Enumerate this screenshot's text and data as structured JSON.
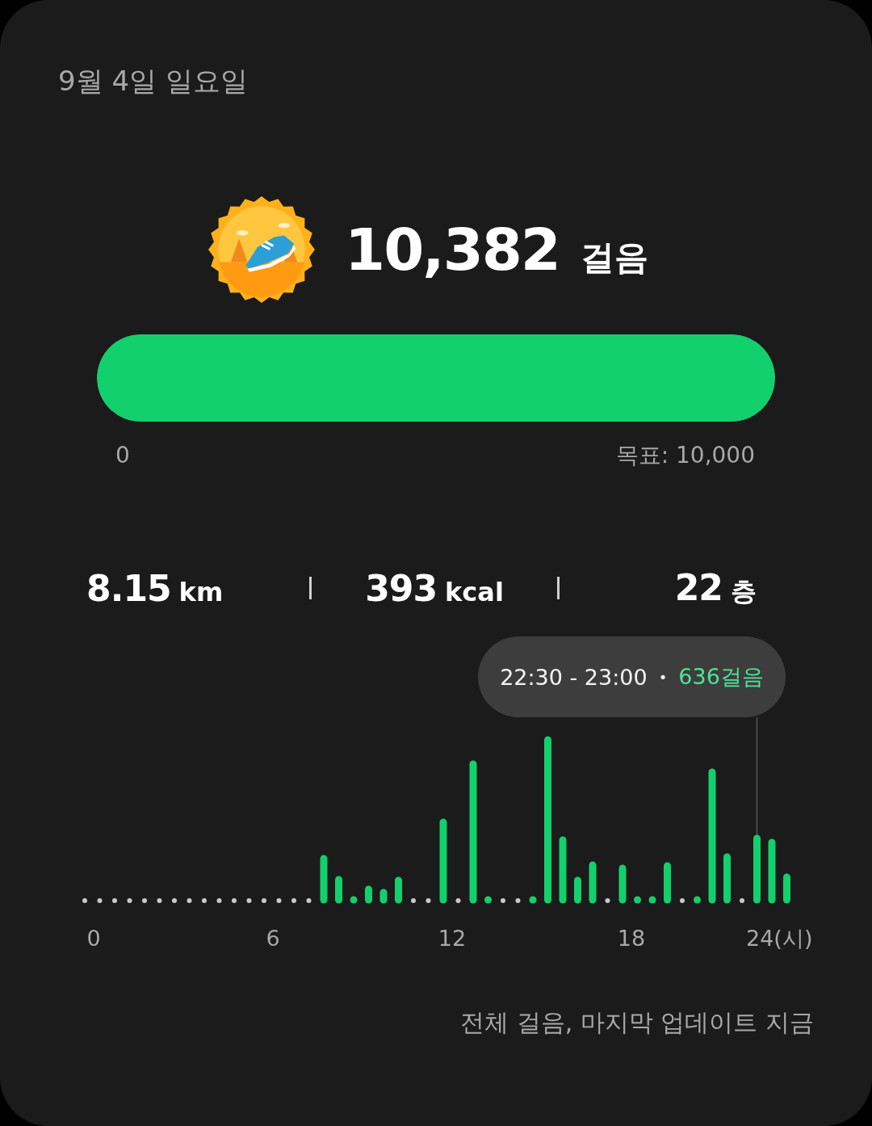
{
  "date": "9월 4일 일요일",
  "steps": {
    "count": "10,382",
    "unit": "걸음"
  },
  "goal_bar": {
    "level": 1,
    "start_label": "0",
    "goal_label": "목표: 10,000"
  },
  "stats": [
    {
      "value": "8.15",
      "unit": "km"
    },
    {
      "value": "393",
      "unit": "kcal"
    },
    {
      "value": "22",
      "unit": "층"
    }
  ],
  "hourly_chart": {
    "tooltip": {
      "time_range": "22:30 - 23:00",
      "separator": "•",
      "steps": "636걸음"
    },
    "axis_labels": [
      "0",
      "6",
      "12",
      "18",
      "24(시)"
    ]
  },
  "footer": "전체 걸음, 마지막 업데이트 지금"
}
